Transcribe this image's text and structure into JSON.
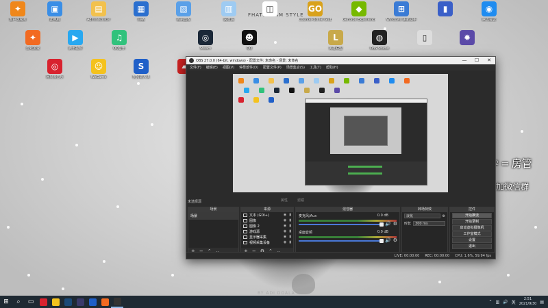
{
  "desktop": {
    "brand": "FHATEGRAM STYLE",
    "artist": "BY ADI DOALA",
    "icons": [
      {
        "label": "客户端服务",
        "color": "#f0871a",
        "glyph": "✦"
      },
      {
        "label": "此电脑",
        "color": "#3a8ee6",
        "glyph": "▣"
      },
      {
        "label": "Administrator",
        "color": "#f2c14e",
        "glyph": "▤"
      },
      {
        "label": "网络",
        "color": "#2a6fcf",
        "glyph": "▦"
      },
      {
        "label": "控制面板",
        "color": "#5aa0e8",
        "glyph": "▧"
      },
      {
        "label": "回收站",
        "color": "#9ecbf2",
        "glyph": "▥"
      },
      {
        "label": "",
        "color": "#ffffff",
        "glyph": "◫"
      },
      {
        "label": "Counter-Strike Global Offensive",
        "color": "#d9a21b",
        "glyph": "GO"
      },
      {
        "label": "GeForce Experience",
        "color": "#76b900",
        "glyph": "◆"
      },
      {
        "label": "Windows 更新助手",
        "color": "#3a7bd5",
        "glyph": "⊞"
      },
      {
        "label": "",
        "color": "#3a5fc8",
        "glyph": "▮"
      },
      {
        "label": "腾讯会议",
        "color": "#1f8cf0",
        "glyph": "◉"
      },
      {
        "label": "游戏加速",
        "color": "#f26a21",
        "glyph": "✦"
      },
      {
        "label": "腾讯视频",
        "color": "#28a8f0",
        "glyph": "▶"
      },
      {
        "label": "QQ音乐",
        "color": "#31c27c",
        "glyph": "♫"
      },
      {
        "label": "Steam",
        "color": "#1b2838",
        "glyph": "◎"
      },
      {
        "label": "QQ",
        "color": "#111111",
        "glyph": "☻"
      },
      {
        "label": "英雄联盟",
        "color": "#c8a94a",
        "glyph": "L"
      },
      {
        "label": "OBS Studio",
        "color": "#222222",
        "glyph": "◍"
      },
      {
        "label": "",
        "color": "#dddddd",
        "glyph": "▯"
      },
      {
        "label": "",
        "color": "#5b4aa8",
        "glyph": "✹"
      },
      {
        "label": "网易云音乐",
        "color": "#d8222e",
        "glyph": "◎"
      },
      {
        "label": "WeGame",
        "color": "#f4c21e",
        "glyph": "☺"
      },
      {
        "label": "搜狗输入法",
        "color": "#1f5fc8",
        "glyph": "S"
      },
      {
        "label": "",
        "color": "#cc2222",
        "glyph": "▰"
      }
    ]
  },
  "overlay": {
    "multiplier": "x2",
    "eq": "=",
    "role": "房管",
    "promo": "办卡加微信群"
  },
  "obs": {
    "title": "OBS 27.0.0 (64-bit, windows) - 配置文件: 未命名 - 场景: 未命名",
    "menu": [
      "文件(F)",
      "编辑(E)",
      "视图(V)",
      "停靠部件(D)",
      "配置文件(P)",
      "场景集合(S)",
      "工具(T)",
      "帮助(H)"
    ],
    "no_source_selected": "未选择源",
    "properties_label": "属性",
    "filters_label": "滤镜",
    "panels": {
      "scenes": "场景",
      "sources": "来源",
      "mixer": "混音器",
      "transitions": "转场特效",
      "controls": "控件"
    },
    "scenes": [
      "场景"
    ],
    "sources": [
      "文本 (GDI+)",
      "图像",
      "图像 2",
      "游戏源",
      "显示器采集",
      "视频采集设备"
    ],
    "mixer": [
      {
        "name": "麦克风/Aux",
        "db": "0.0 dB"
      },
      {
        "name": "桌面音频",
        "db": "0.0 dB"
      }
    ],
    "transition": {
      "value": "淡化",
      "duration_label": "时长",
      "duration": "300 ms"
    },
    "controls": [
      "开始推流",
      "开始录制",
      "启动虚拟摄像机",
      "工作室模式",
      "设置",
      "退出"
    ],
    "status": {
      "live": "LIVE: 00:00:00",
      "rec": "REC: 00:00:00",
      "cpu": "CPU: 1.6%, 59.94 fps"
    }
  },
  "taskbar": {
    "start": "⊞",
    "search": "⌕",
    "apps": [
      {
        "name": "网易云音乐",
        "color": "#d8222e"
      },
      {
        "name": "WeGame",
        "color": "#f4c21e"
      },
      {
        "name": "Steam",
        "color": "#1b4a78"
      },
      {
        "name": "MSI",
        "color": "#3a3a6a"
      },
      {
        "name": "搜狗",
        "color": "#1f5fc8"
      },
      {
        "name": "游戏加速",
        "color": "#f26a21"
      },
      {
        "name": "OBS Studio",
        "color": "#333333"
      }
    ],
    "tray_text": "英",
    "time": "2:51",
    "date": "2021/9/30"
  }
}
